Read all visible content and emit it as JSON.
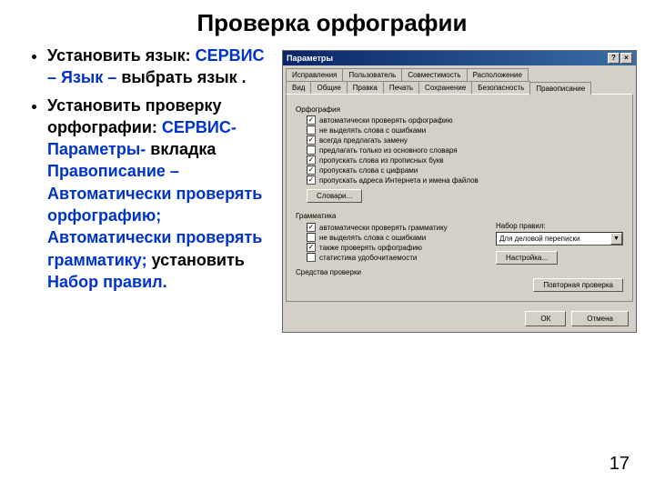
{
  "title": "Проверка орфографии",
  "bullets": {
    "b1_a": "Установить язык: ",
    "b1_b": "СЕРВИС – Язык –",
    "b1_c": "выбрать язык .",
    "b2_a": "Установить проверку орфографии: ",
    "b2_b": "СЕРВИС-Параметры-",
    "b2_c": " вкладка ",
    "b2_d": "Правописание – Автоматически проверять орфографию; Автоматически проверять грамматику;",
    "b2_e": " установить ",
    "b2_f": "Набор правил."
  },
  "win": {
    "title": "Параметры",
    "help": "?",
    "close": "×",
    "tabs_row1": [
      "Исправления",
      "Пользователь",
      "Совместимость",
      "Расположение"
    ],
    "tabs_row2": [
      "Вид",
      "Общие",
      "Правка",
      "Печать",
      "Сохранение",
      "Безопасность",
      "Правописание"
    ],
    "grp_orf": "Орфография",
    "orf_opts": [
      {
        "checked": true,
        "label": "автоматически проверять орфографию"
      },
      {
        "checked": false,
        "label": "не выделять слова с ошибками"
      },
      {
        "checked": true,
        "label": "всегда предлагать замену"
      },
      {
        "checked": false,
        "label": "предлагать только из основного словаря"
      },
      {
        "checked": true,
        "label": "пропускать слова из прописных букв"
      },
      {
        "checked": true,
        "label": "пропускать слова с цифрами"
      },
      {
        "checked": true,
        "label": "пропускать адреса Интернета и имена файлов"
      }
    ],
    "btn_dict": "Словари...",
    "grp_gram": "Грамматика",
    "gram_opts": [
      {
        "checked": true,
        "label": "автоматически проверять грамматику"
      },
      {
        "checked": false,
        "label": "не выделять слова с ошибками"
      },
      {
        "checked": true,
        "label": "также проверять орфографию"
      },
      {
        "checked": false,
        "label": "статистика удобочитаемости"
      }
    ],
    "ruleset_label": "Набор правил:",
    "ruleset_value": "Для деловой переписки",
    "btn_settings": "Настройка...",
    "grp_tools": "Средства проверки",
    "btn_recheck": "Повторная проверка",
    "btn_ok": "ОК",
    "btn_cancel": "Отмена"
  },
  "pagenum": "17"
}
